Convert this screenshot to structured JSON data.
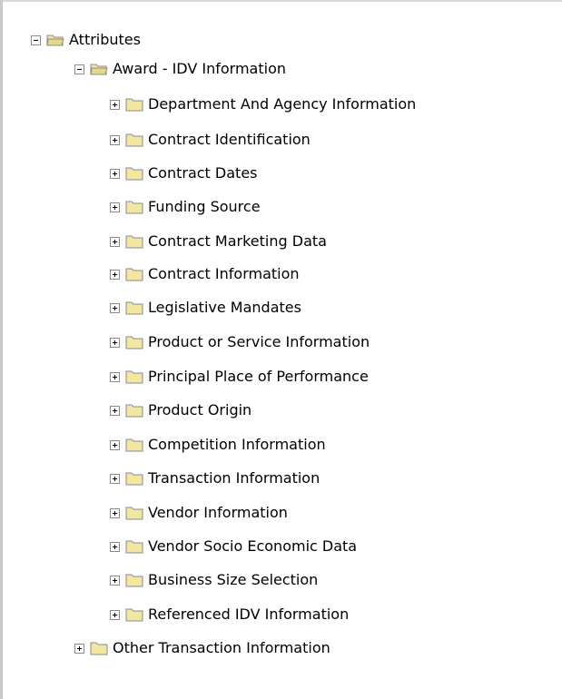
{
  "tree": {
    "root": {
      "label": "Attributes",
      "expanded": true,
      "icon": "folder-open-icon",
      "children": [
        {
          "label": "Award - IDV Information",
          "expanded": true,
          "icon": "folder-open-icon",
          "children": [
            {
              "label": "Department And Agency Information",
              "expanded": false,
              "icon": "folder-icon"
            },
            {
              "label": "Contract Identification",
              "expanded": false,
              "icon": "folder-icon"
            },
            {
              "label": "Contract Dates",
              "expanded": false,
              "icon": "folder-icon"
            },
            {
              "label": "Funding Source",
              "expanded": false,
              "icon": "folder-icon"
            },
            {
              "label": "Contract Marketing Data",
              "expanded": false,
              "icon": "folder-icon"
            },
            {
              "label": "Contract Information",
              "expanded": false,
              "icon": "folder-icon"
            },
            {
              "label": "Legislative Mandates",
              "expanded": false,
              "icon": "folder-icon"
            },
            {
              "label": "Product or Service Information",
              "expanded": false,
              "icon": "folder-icon"
            },
            {
              "label": "Principal Place of Performance",
              "expanded": false,
              "icon": "folder-icon"
            },
            {
              "label": "Product Origin",
              "expanded": false,
              "icon": "folder-icon"
            },
            {
              "label": "Competition Information",
              "expanded": false,
              "icon": "folder-icon"
            },
            {
              "label": "Transaction Information",
              "expanded": false,
              "icon": "folder-icon"
            },
            {
              "label": "Vendor Information",
              "expanded": false,
              "icon": "folder-icon"
            },
            {
              "label": "Vendor Socio Economic Data",
              "expanded": false,
              "icon": "folder-icon"
            },
            {
              "label": "Business Size Selection",
              "expanded": false,
              "icon": "folder-icon"
            },
            {
              "label": "Referenced IDV Information",
              "expanded": false,
              "icon": "folder-icon"
            }
          ]
        },
        {
          "label": "Other Transaction Information",
          "expanded": false,
          "icon": "folder-icon"
        }
      ]
    }
  },
  "colors": {
    "folder_fill": "#f1e7a0",
    "folder_border": "#8a8a8a",
    "toggle_border": "#8c8c8c"
  }
}
